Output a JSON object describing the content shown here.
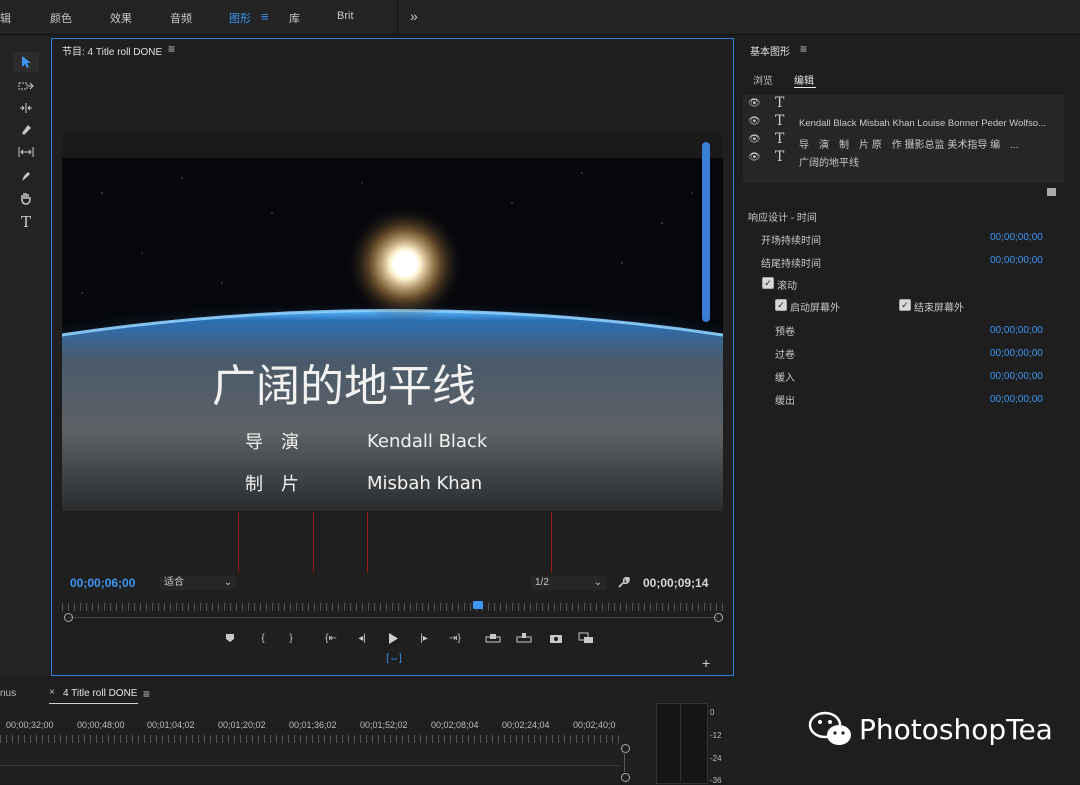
{
  "topbar": {
    "items": [
      "辑",
      "颜色",
      "效果",
      "音频",
      "图形",
      "库",
      "Brit"
    ],
    "active_index": 4,
    "more": "»",
    "menu_icon": "≡"
  },
  "tools": [
    "selection-tool",
    "track-select-tool",
    "ripple-edit-tool",
    "razor-tool",
    "slip-tool",
    "pen-tool",
    "hand-tool",
    "type-tool"
  ],
  "monitor": {
    "title": "节目: 4 Title roll DONE",
    "menu_icon": "≡",
    "video": {
      "title_text": "广阔的地平线",
      "credits": [
        {
          "role": "导　演",
          "name": "Kendall Black"
        },
        {
          "role": "制　片",
          "name": "Misbah Khan"
        }
      ]
    },
    "current_tc": "00;00;06;00",
    "fit": "适合",
    "resolution": "1/2",
    "duration_tc": "00;00;09;14",
    "playhead_fraction": 0.63
  },
  "graphics_panel": {
    "title": "基本图形",
    "menu_icon": "≡",
    "tabs": [
      "浏览",
      "编辑"
    ],
    "active_tab": 1,
    "layers": [
      {
        "text": ""
      },
      {
        "text": "Kendall Black  Misbah Khan  Louise Bonner  Peder Wolfso..."
      },
      {
        "text": "导　演　制　片 原　作 摄影总监 美术指导 编　..."
      },
      {
        "text": "广阔的地平线"
      }
    ],
    "section_title": "响应设计 - 时间",
    "rows": [
      {
        "label": "开场持续时间",
        "value": "00;00;00;00"
      },
      {
        "label": "结尾持续时间",
        "value": "00;00;00;00"
      }
    ],
    "roll_label": "滚动",
    "start_offscreen": "启动屏幕外",
    "end_offscreen": "结束屏幕外",
    "roll_rows": [
      {
        "label": "预卷",
        "value": "00;00;00;00"
      },
      {
        "label": "过卷",
        "value": "00;00;00;00"
      },
      {
        "label": "缓入",
        "value": "00;00;00;00"
      },
      {
        "label": "缓出",
        "value": "00;00;00;00"
      }
    ]
  },
  "timeline": {
    "prev_tab": "nus",
    "close": "×",
    "tab": "4 Title roll DONE",
    "menu_icon": "≡",
    "ticks": [
      "00;00;32;00",
      "00;00;48;00",
      "00;01;04;02",
      "00;01;20;02",
      "00;01;36;02",
      "00;01;52;02",
      "00;02;08;04",
      "00;02;24;04",
      "00;02;40;0"
    ]
  },
  "meter": {
    "labels": [
      "0",
      "-12",
      "-24",
      "-36"
    ]
  },
  "watermark": {
    "text": "PhotoshopTea"
  },
  "colors": {
    "accent": "#3d96f5",
    "border_active": "#2f7fd5",
    "marker_red": "#a21919"
  }
}
